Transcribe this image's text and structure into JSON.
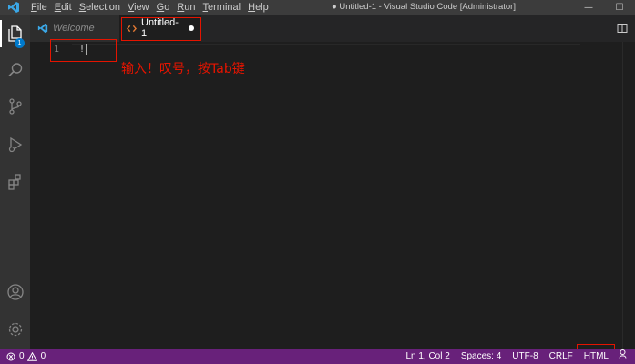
{
  "titlebar": {
    "menu": [
      {
        "id": "file",
        "accel": "F",
        "rest": "ile"
      },
      {
        "id": "edit",
        "accel": "E",
        "rest": "dit"
      },
      {
        "id": "selection",
        "accel": "S",
        "rest": "election"
      },
      {
        "id": "view",
        "accel": "V",
        "rest": "iew"
      },
      {
        "id": "go",
        "accel": "G",
        "rest": "o"
      },
      {
        "id": "run",
        "accel": "R",
        "rest": "un"
      },
      {
        "id": "terminal",
        "accel": "T",
        "rest": "erminal"
      },
      {
        "id": "help",
        "accel": "H",
        "rest": "elp"
      }
    ],
    "window_title": "● Untitled-1 - Visual Studio Code [Administrator]",
    "controls": {
      "minimize": "—",
      "maximize": "☐"
    }
  },
  "activitybar": {
    "explorer_badge": "1",
    "icons": [
      "explorer-icon",
      "search-icon",
      "source-control-icon",
      "run-debug-icon",
      "extensions-icon",
      "account-icon",
      "settings-gear-icon"
    ]
  },
  "tabs": [
    {
      "label": "Welcome",
      "icon": "vscode-logo-icon"
    },
    {
      "label": "Untitled-1",
      "icon": "html-file-icon",
      "dirty": true
    }
  ],
  "editor": {
    "line_number": "1",
    "code": "!",
    "annotation": "输入！叹号，按Tab键"
  },
  "statusbar": {
    "errors": "0",
    "warnings": "0",
    "position": "Ln 1, Col 2",
    "spaces": "Spaces: 4",
    "encoding": "UTF-8",
    "eol": "CRLF",
    "language": "HTML"
  },
  "colors": {
    "statusbar": "#68217a",
    "activitybar": "#333333",
    "editor_bg": "#1e1e1e",
    "highlight": "#e51400"
  }
}
